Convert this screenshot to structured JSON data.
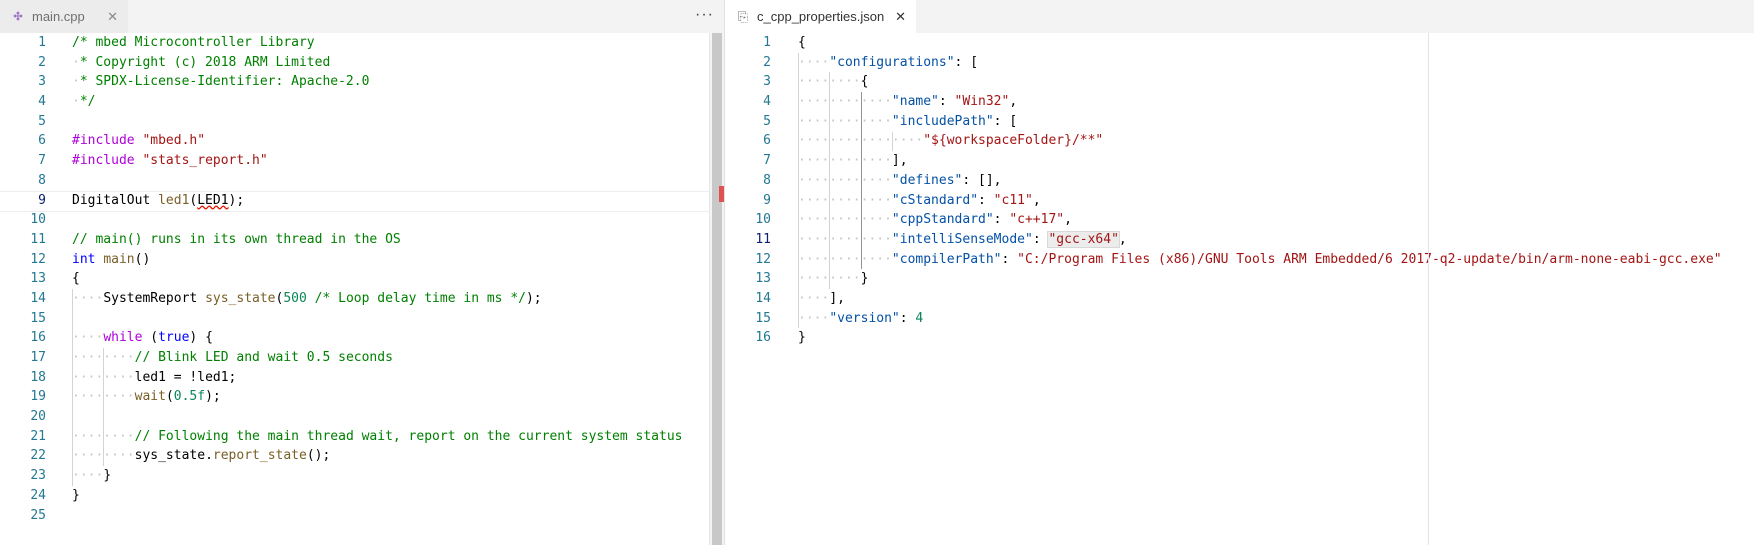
{
  "left_editor": {
    "tab": {
      "label": "main.cpp",
      "icon": "cpp-file-icon",
      "close_glyph": "✕"
    },
    "more_actions_glyph": "···",
    "line_numbers": [
      "1",
      "2",
      "3",
      "4",
      "5",
      "6",
      "7",
      "8",
      "9",
      "10",
      "11",
      "12",
      "13",
      "14",
      "15",
      "16",
      "17",
      "18",
      "19",
      "20",
      "21",
      "22",
      "23",
      "24",
      "25"
    ],
    "lines": [
      "/* mbed Microcontroller Library",
      " * Copyright (c) 2018 ARM Limited",
      " * SPDX-License-Identifier: Apache-2.0",
      " */",
      "",
      "#include \"mbed.h\"",
      "#include \"stats_report.h\"",
      "",
      "DigitalOut led1(LED1);",
      "",
      "// main() runs in its own thread in the OS",
      "int main()",
      "{",
      "    SystemReport sys_state(500 /* Loop delay time in ms */);",
      "",
      "    while (true) {",
      "        // Blink LED and wait 0.5 seconds",
      "        led1 = !led1;",
      "        wait(0.5f);",
      "",
      "        // Following the main thread wait, report on the current system status",
      "        sys_state.report_state();",
      "    }",
      "}",
      ""
    ],
    "current_line": "9",
    "error_squiggle_text": "LED1"
  },
  "right_editor": {
    "tab": {
      "label": "c_cpp_properties.json",
      "icon": "json-file-icon",
      "close_glyph": "✕"
    },
    "line_numbers": [
      "1",
      "2",
      "3",
      "4",
      "5",
      "6",
      "7",
      "8",
      "9",
      "10",
      "11",
      "12",
      "13",
      "14",
      "15",
      "16"
    ],
    "lines": [
      "{",
      "    \"configurations\": [",
      "        {",
      "            \"name\": \"Win32\",",
      "            \"includePath\": [",
      "                \"${workspaceFolder}/**\"",
      "            ],",
      "            \"defines\": [],",
      "            \"cStandard\": \"c11\",",
      "            \"cppStandard\": \"c++17\",",
      "            \"intelliSenseMode\": \"gcc-x64\",",
      "            \"compilerPath\": \"C:/Program Files (x86)/GNU Tools ARM Embedded/6 2017-q2-update/bin/arm-none-eabi-gcc.exe\"",
      "        }",
      "    ],",
      "    \"version\": 4",
      "}"
    ],
    "current_line": "11",
    "highlighted_value": "gcc-x64"
  },
  "colors": {
    "comment": "#008000",
    "keyword": "#0000ff",
    "control": "#af00db",
    "string": "#a31515",
    "number": "#098658",
    "function": "#795e26",
    "json_key": "#0451a5",
    "line_number": "#237893",
    "error": "#e51400"
  }
}
